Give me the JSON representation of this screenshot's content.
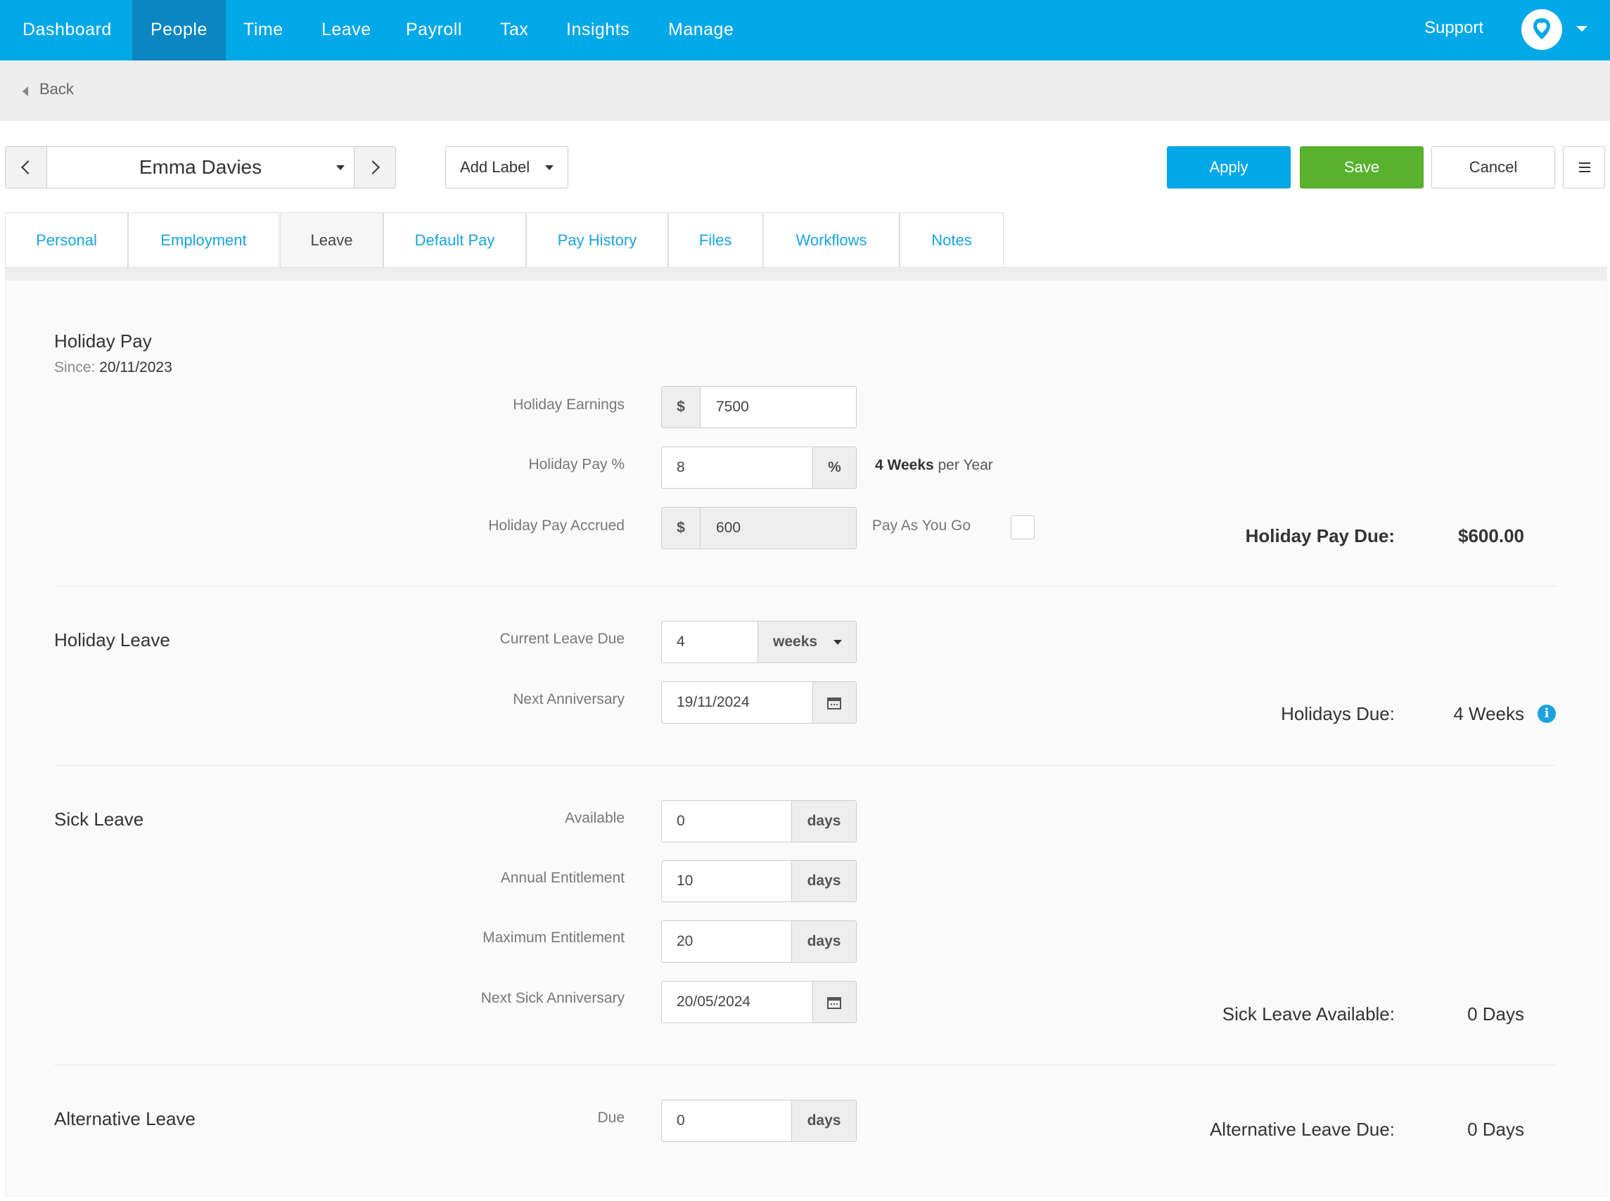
{
  "nav": {
    "items": [
      "Dashboard",
      "People",
      "Time",
      "Leave",
      "Payroll",
      "Tax",
      "Insights",
      "Manage"
    ],
    "active": "People",
    "support": "Support"
  },
  "back": {
    "label": "Back"
  },
  "toolbar": {
    "employee": "Emma Davies",
    "add_label": "Add Label",
    "apply": "Apply",
    "save": "Save",
    "cancel": "Cancel"
  },
  "tabs": [
    "Personal",
    "Employment",
    "Leave",
    "Default Pay",
    "Pay History",
    "Files",
    "Workflows",
    "Notes"
  ],
  "active_tab": "Leave",
  "holiday_pay": {
    "title": "Holiday Pay",
    "since_label": "Since:",
    "since_value": "20/11/2023",
    "earnings_label": "Holiday Earnings",
    "earnings_prefix": "$",
    "earnings_value": "7500",
    "pct_label": "Holiday Pay %",
    "pct_value": "8",
    "pct_suffix": "%",
    "weeks_bold": "4 Weeks",
    "weeks_rest": " per Year",
    "accrued_label": "Holiday Pay Accrued",
    "accrued_prefix": "$",
    "accrued_value": "600",
    "payg_label": "Pay As You Go",
    "due_label": "Holiday Pay Due:",
    "due_value": "$600.00"
  },
  "holiday_leave": {
    "title": "Holiday Leave",
    "current_label": "Current Leave Due",
    "current_value": "4",
    "current_unit": "weeks",
    "anniv_label": "Next Anniversary",
    "anniv_value": "19/11/2024",
    "due_label": "Holidays Due:",
    "due_value": "4 Weeks"
  },
  "sick_leave": {
    "title": "Sick Leave",
    "available_label": "Available",
    "available_value": "0",
    "annual_label": "Annual Entitlement",
    "annual_value": "10",
    "max_label": "Maximum Entitlement",
    "max_value": "20",
    "unit": "days",
    "anniv_label": "Next Sick Anniversary",
    "anniv_value": "20/05/2024",
    "summary_label": "Sick Leave Available:",
    "summary_value": "0 Days"
  },
  "alt_leave": {
    "title": "Alternative Leave",
    "due_label": "Due",
    "due_value": "0",
    "unit": "days",
    "summary_label": "Alternative Leave Due:",
    "summary_value": "0 Days"
  },
  "colors": {
    "brand": "#00a8e8",
    "nav_active": "#0a86c0",
    "save": "#58b22e",
    "link": "#1aa3dd"
  }
}
